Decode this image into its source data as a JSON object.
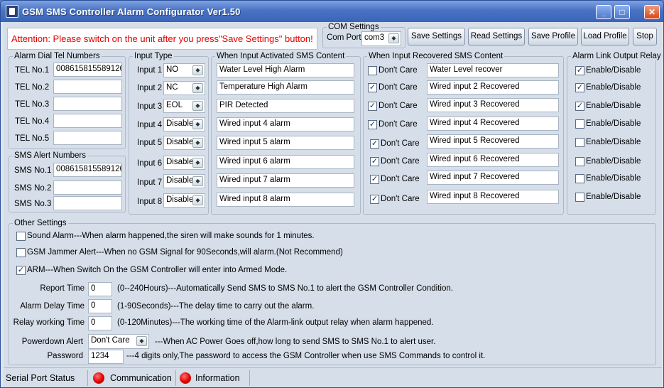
{
  "window": {
    "title": "GSM SMS Controller Alarm Configurator Ver1.50"
  },
  "attention": "Attention: Please switch on the unit after you press\"Save Settings\" button!",
  "com": {
    "legend": "COM Settings",
    "port_label": "Com Port",
    "port_value": "com3"
  },
  "toolbar": {
    "save": "Save Settings",
    "read": "Read Settings",
    "save_profile": "Save Profile",
    "load_profile": "Load Profile",
    "stop": "Stop"
  },
  "tel": {
    "legend": "Alarm Dial Tel Numbers",
    "rows": [
      {
        "label": "TEL No.1",
        "value": "008615815589126"
      },
      {
        "label": "TEL No.2",
        "value": ""
      },
      {
        "label": "TEL No.3",
        "value": ""
      },
      {
        "label": "TEL No.4",
        "value": ""
      },
      {
        "label": "TEL No.5",
        "value": ""
      }
    ]
  },
  "sms": {
    "legend": "SMS Alert Numbers",
    "rows": [
      {
        "label": "SMS No.1",
        "value": "008615815589126"
      },
      {
        "label": "SMS No.2",
        "value": ""
      },
      {
        "label": "SMS No.3",
        "value": ""
      }
    ]
  },
  "input_type": {
    "legend": "Input Type",
    "rows": [
      {
        "label": "Input 1",
        "value": "NO"
      },
      {
        "label": "Input 2",
        "value": "NC"
      },
      {
        "label": "Input 3",
        "value": "EOL"
      },
      {
        "label": "Input 4",
        "value": "Disable"
      },
      {
        "label": "Input 5",
        "value": "Disable"
      },
      {
        "label": "Input 6",
        "value": "Disable"
      },
      {
        "label": "Input 7",
        "value": "Disable"
      },
      {
        "label": "Input 8",
        "value": "Disable"
      }
    ]
  },
  "activated": {
    "legend": "When Input Activated SMS Content",
    "rows": [
      "Water Level High Alarm",
      "Temperature High Alarm",
      "PIR Detected",
      "Wired input 4 alarm",
      "Wired input 5 alarm",
      "Wired input 6 alarm",
      "Wired input 7 alarm",
      "Wired input 8 alarm"
    ]
  },
  "recovered": {
    "legend": "When Input Recovered SMS Content",
    "dont_care": "Don't Care",
    "rows": [
      {
        "checked": false,
        "value": "Water Level recover"
      },
      {
        "checked": true,
        "value": "Wired input 2 Recovered"
      },
      {
        "checked": true,
        "value": "Wired input 3 Recovered"
      },
      {
        "checked": true,
        "value": "Wired input 4 Recovered"
      },
      {
        "checked": true,
        "value": "Wired input 5 Recovered"
      },
      {
        "checked": true,
        "value": "Wired input 6 Recovered"
      },
      {
        "checked": true,
        "value": "Wired input 7 Recovered"
      },
      {
        "checked": true,
        "value": "Wired input 8 Recovered"
      }
    ]
  },
  "relay": {
    "legend": "Alarm Link Output Relay",
    "label": "Enable/Disable",
    "rows": [
      true,
      true,
      true,
      false,
      false,
      false,
      false,
      false
    ]
  },
  "other": {
    "legend": "Other Settings",
    "sound": {
      "checked": false,
      "text": "Sound Alarm---When alarm happened,the siren will make sounds for 1 minutes."
    },
    "jammer": {
      "checked": false,
      "text": "GSM Jammer Alert---When no GSM Signal for 90Seconds,will alarm.(Not Recommend)"
    },
    "arm": {
      "checked": true,
      "text": "ARM---When Switch On the GSM Controller will enter into Armed Mode."
    },
    "report": {
      "label": "Report Time",
      "value": "0",
      "desc": "(0--240Hours)---Automatically Send SMS to SMS No.1 to alert the GSM Controller Condition."
    },
    "delay": {
      "label": "Alarm Delay Time",
      "value": "0",
      "desc": "(1-90Seconds)---The delay time to carry out the alarm."
    },
    "relay_time": {
      "label": "Relay working Time",
      "value": "0",
      "desc": "(0-120Minutes)---The working time of the Alarm-link output relay when alarm happened."
    },
    "powerdown": {
      "label": "Powerdown Alert",
      "value": "Don't Care",
      "desc": "---When AC Power Goes off,how long to send SMS to SMS No.1 to alert user."
    },
    "password": {
      "label": "Password",
      "value": "1234",
      "desc": "---4 digits only,The password to access the GSM Controller when use SMS Commands to control it."
    }
  },
  "status": {
    "serial": "Serial Port Status",
    "communication": "Communication",
    "information": "Information"
  },
  "colors": {
    "titlebar": "#3a64b8",
    "attention": "#e50000",
    "led": "#e00000"
  }
}
